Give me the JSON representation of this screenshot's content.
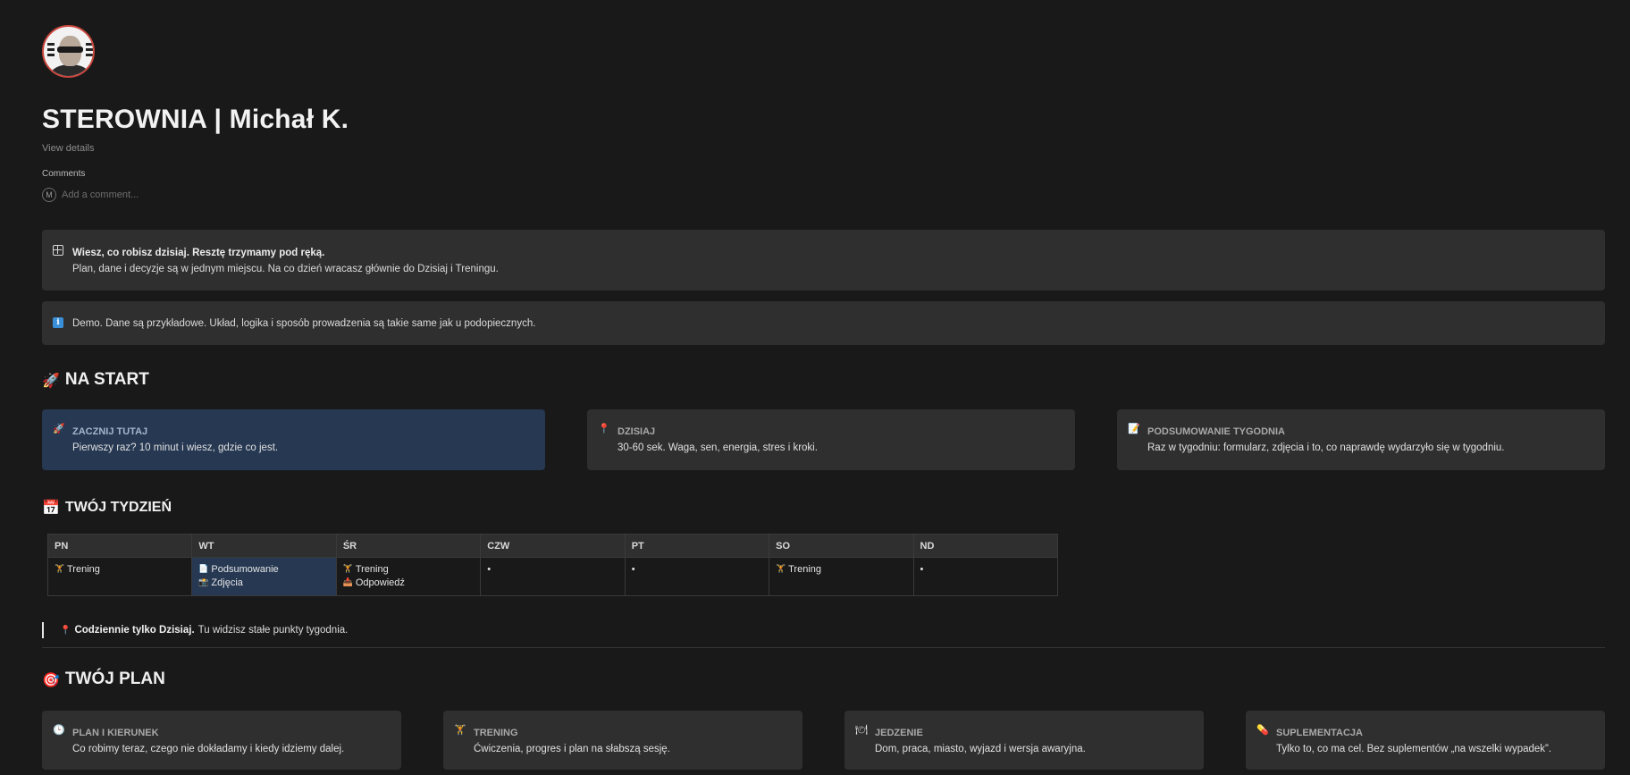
{
  "page": {
    "title": "STEROWNIA | Michał K.",
    "view_details": "View details"
  },
  "comments": {
    "label": "Comments",
    "avatar_initial": "M",
    "placeholder": "Add a comment..."
  },
  "callouts": [
    {
      "icon": "grid-icon",
      "title": "Wiesz, co robisz dzisiaj. Resztę trzymamy pod ręką.",
      "text": "Plan, dane i decyzje są w jednym miejscu. Na co dzień wracasz głównie do Dzisiaj i Treningu."
    },
    {
      "icon": "info-icon",
      "text": "Demo. Dane są przykładowe. Układ, logika i sposób prowadzenia są takie same jak u podopiecznych."
    }
  ],
  "na_start": {
    "heading": "NA START",
    "emoji": "🚀",
    "cards": [
      {
        "icon": "🚀",
        "title": "ZACZNIJ TUTAJ",
        "desc": "Pierwszy raz? 10 minut i wiesz, gdzie co jest."
      },
      {
        "icon": "📍",
        "title": "DZISIAJ",
        "desc": "30-60 sek. Waga, sen, energia, stres i kroki."
      },
      {
        "icon": "📝",
        "title": "PODSUMOWANIE TYGODNIA",
        "desc": "Raz w tygodniu: formularz, zdjęcia i to, co naprawdę wydarzyło się w tygodniu."
      }
    ]
  },
  "week": {
    "heading": "TWÓJ TYDZIEŃ",
    "emoji": "📅",
    "days": [
      "PN",
      "WT",
      "ŚR",
      "CZW",
      "PT",
      "SO",
      "ND"
    ],
    "cells": [
      [
        {
          "icon": "🏋",
          "label": "Trening"
        }
      ],
      [
        {
          "icon": "📄",
          "label": "Podsumowanie"
        },
        {
          "icon": "📸",
          "label": "Zdjęcia"
        }
      ],
      [
        {
          "icon": "🏋",
          "label": "Trening"
        },
        {
          "icon": "📥",
          "label": "Odpowiedź"
        }
      ],
      [
        {
          "icon": "",
          "label": "•"
        }
      ],
      [
        {
          "icon": "",
          "label": "•"
        }
      ],
      [
        {
          "icon": "🏋",
          "label": "Trening"
        }
      ],
      [
        {
          "icon": "",
          "label": "•"
        }
      ]
    ],
    "note_bold": "Codziennie tylko Dzisiaj.",
    "note_text": "Tu widzisz stałe punkty tygodnia.",
    "note_icon": "📍"
  },
  "plan": {
    "heading": "TWÓJ PLAN",
    "emoji": "🎯",
    "cards": [
      {
        "icon": "🕒",
        "title": "PLAN I KIERUNEK",
        "desc": "Co robimy teraz, czego nie dokładamy i kiedy idziemy dalej."
      },
      {
        "icon": "🏋",
        "title": "TRENING",
        "desc": "Ćwiczenia, progres i plan na słabszą sesję."
      },
      {
        "icon": "🍽",
        "title": "JEDZENIE",
        "desc": "Dom, praca, miasto, wyjazd i wersja awaryjna."
      },
      {
        "icon": "💊",
        "title": "SUPLEMENTACJA",
        "desc": "Tylko to, co ma cel. Bez suplementów „na wszelki wypadek”."
      }
    ]
  }
}
